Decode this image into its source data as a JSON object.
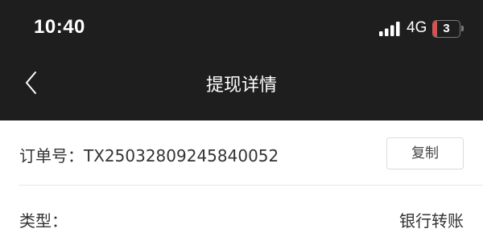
{
  "status_bar": {
    "time": "10:40",
    "network": "4G",
    "battery_level": "3",
    "battery_fraction": 0.15,
    "battery_color": "#e84a4a"
  },
  "nav": {
    "title": "提现详情",
    "back_icon": "chevron-left-icon"
  },
  "order": {
    "label": "订单号：",
    "number": "TX25032809245840052",
    "copy_label": "复制"
  },
  "type_row": {
    "label": "类型：",
    "value": "银行转账"
  },
  "colors": {
    "header_bg": "#1e1e1e",
    "text": "#333333",
    "divider": "#e6e6e6"
  }
}
